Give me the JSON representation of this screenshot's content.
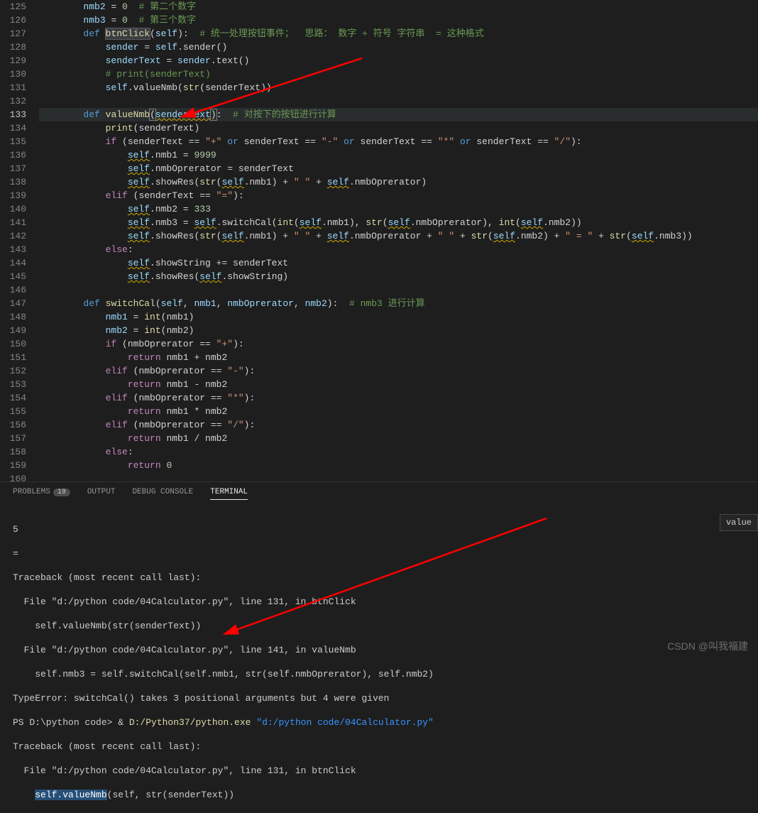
{
  "gutter": {
    "start": 125,
    "end": 160,
    "highlight": 133
  },
  "code": {
    "l125": {
      "a": "nmb2 = ",
      "b": "0",
      "c": " # 第二个数字"
    },
    "l126": {
      "a": "nmb3 = ",
      "b": "0",
      "c": " # 第三个数字"
    },
    "l127": {
      "a": "def ",
      "b": "btnClick",
      "c": "(",
      "d": "self",
      "e": "):",
      "f": "# 统一处理按钮事件；  思路： 数字 + 符号 字符串  = 这种格式"
    },
    "l128": {
      "a": "sender = ",
      "b": "self",
      "c": ".sender()"
    },
    "l129": {
      "a": "senderText = sender.text()"
    },
    "l130": {
      "a": "# print(senderText)"
    },
    "l131": {
      "a": "self",
      "b": ".valueNmb(",
      "c": "str",
      "d": "(senderText))"
    },
    "l133": {
      "a": "def ",
      "b": "valueNmb",
      "c": "(",
      "d": "senderText",
      "e": ")",
      "f": ":",
      "g": "# 对按下的按钮进行计算"
    },
    "l134": {
      "a": "print",
      "b": "(senderText)"
    },
    "l135": {
      "a": "if ",
      "b": "(senderText == ",
      "c": "\"+\"",
      "d": " or ",
      "e": "senderText == ",
      "f": "\"-\"",
      "g": " or ",
      "h": "senderText == ",
      "i": "\"*\"",
      "j": " or ",
      "k": "senderText == ",
      "l": "\"/\"",
      "m": "):"
    },
    "l136": {
      "a": "self",
      "b": ".nmb1 = ",
      "c": "9999"
    },
    "l137": {
      "a": "self",
      "b": ".nmbOprerator = senderText"
    },
    "l138": {
      "a": "self",
      "b": ".showRes(",
      "c": "str",
      "d": "(",
      "e": "self",
      "f": ".nmb1) + ",
      "g": "\" \"",
      "h": " + ",
      "i": "self",
      "j": ".nmbOprerator)"
    },
    "l139": {
      "a": "elif ",
      "b": "(senderText == ",
      "c": "\"=\"",
      "d": "):"
    },
    "l140": {
      "a": "self",
      "b": ".nmb2 = ",
      "c": "333"
    },
    "l141": {
      "a": "self",
      "b": ".nmb3 = ",
      "c": "self",
      "d": ".switchCal(",
      "e": "int",
      "f": "(",
      "g": "self",
      "h": ".nmb1), ",
      "i": "str",
      "j": "(",
      "k": "self",
      "l": ".nmbOprerator), ",
      "m": "int",
      "n": "(",
      "o": "self",
      "p": ".nmb2))"
    },
    "l142": {
      "a": "self",
      "b": ".showRes(",
      "c": "str",
      "d": "(",
      "e": "self",
      "f": ".nmb1) + ",
      "g": "\" \"",
      "h": " + ",
      "i": "self",
      "j": ".nmbOprerator + ",
      "k": "\" \"",
      "l": " + ",
      "m": "str",
      "n": "(",
      "o": "self",
      "p": ".nmb2) + ",
      "q": "\" = \"",
      "r": " + ",
      "s": "str",
      "t": "(",
      "u": "self",
      "v": ".nmb3))"
    },
    "l143": {
      "a": "else",
      "b": ":"
    },
    "l144": {
      "a": "self",
      "b": ".showString += senderText"
    },
    "l145": {
      "a": "self",
      "b": ".showRes(",
      "c": "self",
      "d": ".showString)"
    },
    "l147": {
      "a": "def ",
      "b": "switchCal",
      "c": "(",
      "d": "self",
      "e": ", ",
      "f": "nmb1",
      "g": ", ",
      "h": "nmbOprerator",
      "i": ", ",
      "j": "nmb2",
      "k": "):",
      "l": "# nmb3 进行计算"
    },
    "l148": {
      "a": "nmb1 = ",
      "b": "int",
      "c": "(nmb1)"
    },
    "l149": {
      "a": "nmb2 = ",
      "b": "int",
      "c": "(nmb2)"
    },
    "l150": {
      "a": "if ",
      "b": "(nmbOprerator == ",
      "c": "\"+\"",
      "d": "):"
    },
    "l151": {
      "a": "return ",
      "b": "nmb1 + nmb2"
    },
    "l152": {
      "a": "elif ",
      "b": "(nmbOprerator == ",
      "c": "\"-\"",
      "d": "):"
    },
    "l153": {
      "a": "return ",
      "b": "nmb1 - nmb2"
    },
    "l154": {
      "a": "elif ",
      "b": "(nmbOprerator == ",
      "c": "\"*\"",
      "d": "):"
    },
    "l155": {
      "a": "return ",
      "b": "nmb1 * nmb2"
    },
    "l156": {
      "a": "elif ",
      "b": "(nmbOprerator == ",
      "c": "\"/\"",
      "d": "):"
    },
    "l157": {
      "a": "return ",
      "b": "nmb1 / nmb2"
    },
    "l158": {
      "a": "else",
      "b": ":"
    },
    "l159": {
      "a": "return ",
      "b": "0"
    }
  },
  "tabs": {
    "problems": "PROBLEMS",
    "problems_count": "19",
    "output": "OUTPUT",
    "debug": "DEBUG CONSOLE",
    "terminal": "TERMINAL"
  },
  "terminal": {
    "l1": "5",
    "l2": "=",
    "l3": "Traceback (most recent call last):",
    "l4": "  File \"d:/python code/04Calculator.py\", line 131, in btnClick",
    "l5": "    self.valueNmb(str(senderText))",
    "l6": "  File \"d:/python code/04Calculator.py\", line 141, in valueNmb",
    "l7": "    self.nmb3 = self.switchCal(self.nmb1, str(self.nmbOprerator), self.nmb2)",
    "l8": "TypeError: switchCal() takes 3 positional arguments but 4 were given",
    "l9a": "PS D:\\python code> & ",
    "l9b": "D:/Python37/python.exe",
    "l9c": " \"d:/python code/04Calculator.py\"",
    "l10": "Traceback (most recent call last):",
    "l11": "  File \"d:/python code/04Calculator.py\", line 131, in btnClick",
    "l12a": "    ",
    "l12b": "self.valueNmb",
    "l12c": "(self, str(senderText))"
  },
  "hint": "value",
  "watermark": "CSDN @叫我福建"
}
